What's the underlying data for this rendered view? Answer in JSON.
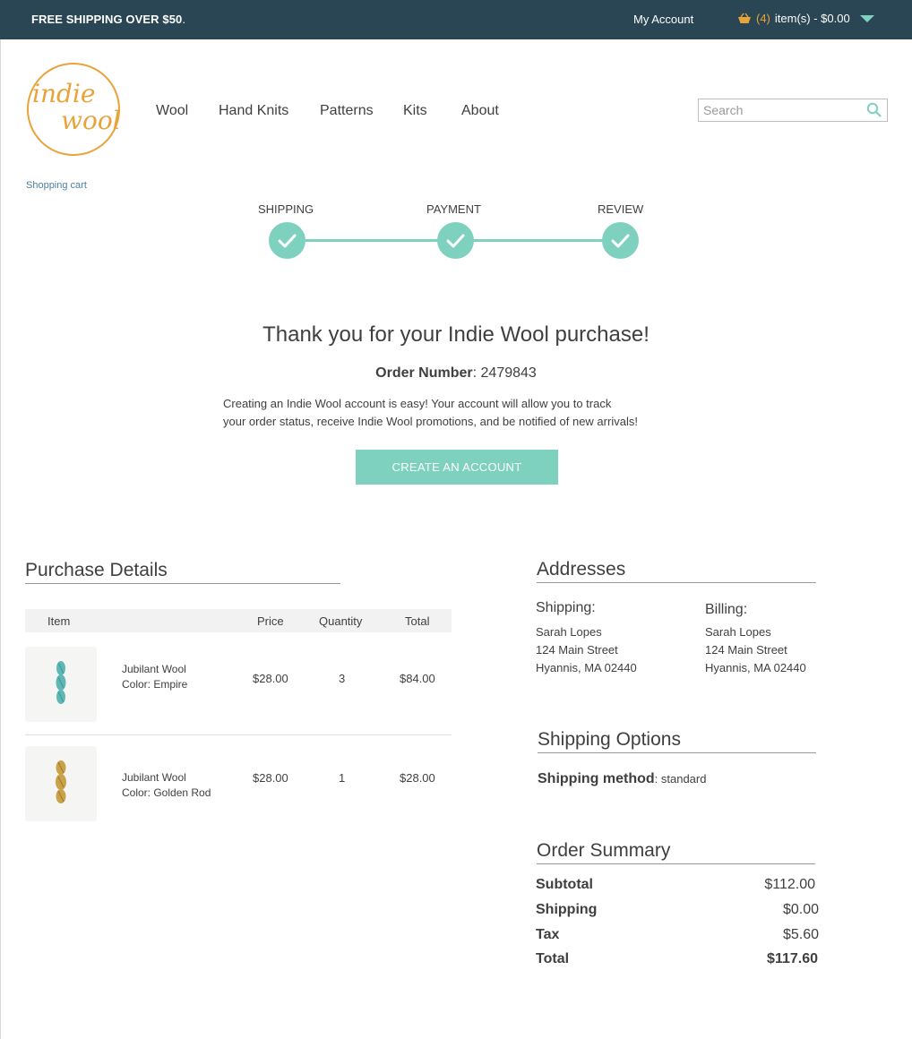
{
  "topbar": {
    "promo": "FREE SHIPPING OVER $50",
    "promo_dot": ".",
    "my_account": "My Account",
    "cart_count": "(4)",
    "cart_text": "item(s) - $0.00"
  },
  "logo": {
    "line1": "indie",
    "line2": "wool"
  },
  "nav": [
    "Wool",
    "Hand Knits",
    "Patterns",
    "Kits",
    "About"
  ],
  "search": {
    "placeholder": "Search"
  },
  "breadcrumb": "Shopping cart",
  "steps": [
    "SHIPPING",
    "PAYMENT",
    "REVIEW"
  ],
  "confirmation": {
    "heading": "Thank you for your Indie Wool purchase!",
    "order_label": "Order Number",
    "order_sep": ":",
    "order_number": "2479843",
    "message_line1": "Creating an Indie Wool account is easy! Your account will allow you to track",
    "message_line2": "your order status, receive Indie Wool promotions, and be notified of new arrivals!",
    "cta": "CREATE AN ACCOUNT"
  },
  "purchase": {
    "heading": "Purchase Details",
    "columns": [
      "Item",
      "Price",
      "Quantity",
      "Total"
    ],
    "items": [
      {
        "name": "Jubilant Wool",
        "color": "Color: Empire",
        "price": "$28.00",
        "qty": "3",
        "total": "$84.00",
        "yarn_color": "#5fb8b4"
      },
      {
        "name": "Jubilant Wool",
        "color": "Color: Golden Rod",
        "price": "$28.00",
        "qty": "1",
        "total": "$28.00",
        "yarn_color": "#c9a24a"
      }
    ]
  },
  "addresses": {
    "heading": "Addresses",
    "shipping_label": "Shipping:",
    "billing_label": "Billing:",
    "shipping": [
      "Sarah Lopes",
      "124 Main Street",
      "Hyannis, MA 02440"
    ],
    "billing": [
      "Sarah Lopes",
      "124 Main Street",
      "Hyannis, MA 02440"
    ]
  },
  "shipping_options": {
    "heading": "Shipping Options",
    "method_label": "Shipping method",
    "method_value": ": standard"
  },
  "summary": {
    "heading": "Order Summary",
    "rows": [
      {
        "label": "Subtotal",
        "value": "$112.00"
      },
      {
        "label": "Shipping",
        "value": "$0.00"
      },
      {
        "label": "Tax",
        "value": "$5.60"
      },
      {
        "label": "Total",
        "value": "$117.60"
      }
    ]
  },
  "colors": {
    "accent": "#7fd1bf",
    "brand": "#e8a33a",
    "topbar": "#2a4553"
  }
}
